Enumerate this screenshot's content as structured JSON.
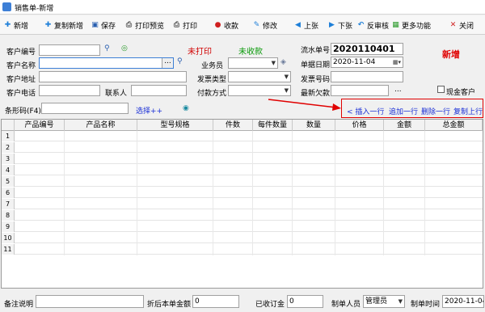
{
  "window": {
    "title": "销售单-新增"
  },
  "toolbar": [
    {
      "label": "新增",
      "icon": "plus-icon",
      "glyph": "✚",
      "color": "#1e7fd8"
    },
    {
      "label": "复制新增",
      "icon": "copy-add-icon",
      "glyph": "✚",
      "color": "#1e7fd8"
    },
    {
      "label": "保存",
      "icon": "save-icon",
      "glyph": "▣",
      "color": "#2a5fb0"
    },
    {
      "label": "打印预览",
      "icon": "print-preview-icon",
      "glyph": "⎙",
      "color": "#555555"
    },
    {
      "label": "打印",
      "icon": "print-icon",
      "glyph": "⎙",
      "color": "#555555"
    },
    {
      "label": "收款",
      "icon": "receive-icon",
      "glyph": "●",
      "color": "#d02020"
    },
    {
      "label": "修改",
      "icon": "edit-icon",
      "glyph": "✎",
      "color": "#1e7fd8"
    },
    {
      "label": "上张",
      "icon": "prev-icon",
      "glyph": "◀",
      "color": "#1e7fd8"
    },
    {
      "label": "下张",
      "icon": "next-icon",
      "glyph": "▶",
      "color": "#1e7fd8"
    },
    {
      "label": "反审核",
      "icon": "unaudit-icon",
      "glyph": "↶",
      "color": "#1e7fd8"
    },
    {
      "label": "更多功能",
      "icon": "more-icon",
      "glyph": "▦",
      "color": "#2a9a2a"
    },
    {
      "label": "关闭",
      "icon": "close-icon",
      "glyph": "✕",
      "color": "#d02020"
    }
  ],
  "form": {
    "customer_code_label": "客户编号",
    "customer_name_label": "客户名称",
    "customer_address_label": "客户地址",
    "customer_phone_label": "客户电话",
    "contact_label": "联系人",
    "print_status": "未打印",
    "payment_status": "未收款",
    "salesman_label": "业务员",
    "invoice_type_label": "发票类型",
    "payment_method_label": "付款方式",
    "serial_label": "流水单号",
    "serial_value": "2020110401",
    "date_label": "单据日期",
    "date_value": "2020-11-04",
    "invoice_no_label": "发票号码",
    "latest_debt_label": "最新欠款",
    "mode_badge": "新增",
    "cash_customer_label": "现金客户",
    "barcode_label": "条形码(F4)",
    "select_link": "选择++"
  },
  "row_actions": {
    "insert": "< 插入一行",
    "append": "追加一行",
    "delete": "删除一行",
    "copy_up": "复制上行"
  },
  "grid": {
    "columns": [
      "产品编号",
      "产品名称",
      "型号规格",
      "件数",
      "每件数量",
      "数量",
      "价格",
      "金额",
      "总金额"
    ],
    "row_numbers": [
      "1",
      "2",
      "3",
      "4",
      "5",
      "6",
      "7",
      "8",
      "9",
      "10",
      "11"
    ]
  },
  "footer": {
    "remark_label": "备注说明",
    "discount_label": "折后本单金额",
    "discount_value": "0",
    "deposit_label": "已收订金",
    "deposit_value": "0",
    "creator_label": "制单人员",
    "creator_value": "管理员",
    "create_time_label": "制单时间",
    "create_time_value": "2020-11-04"
  }
}
